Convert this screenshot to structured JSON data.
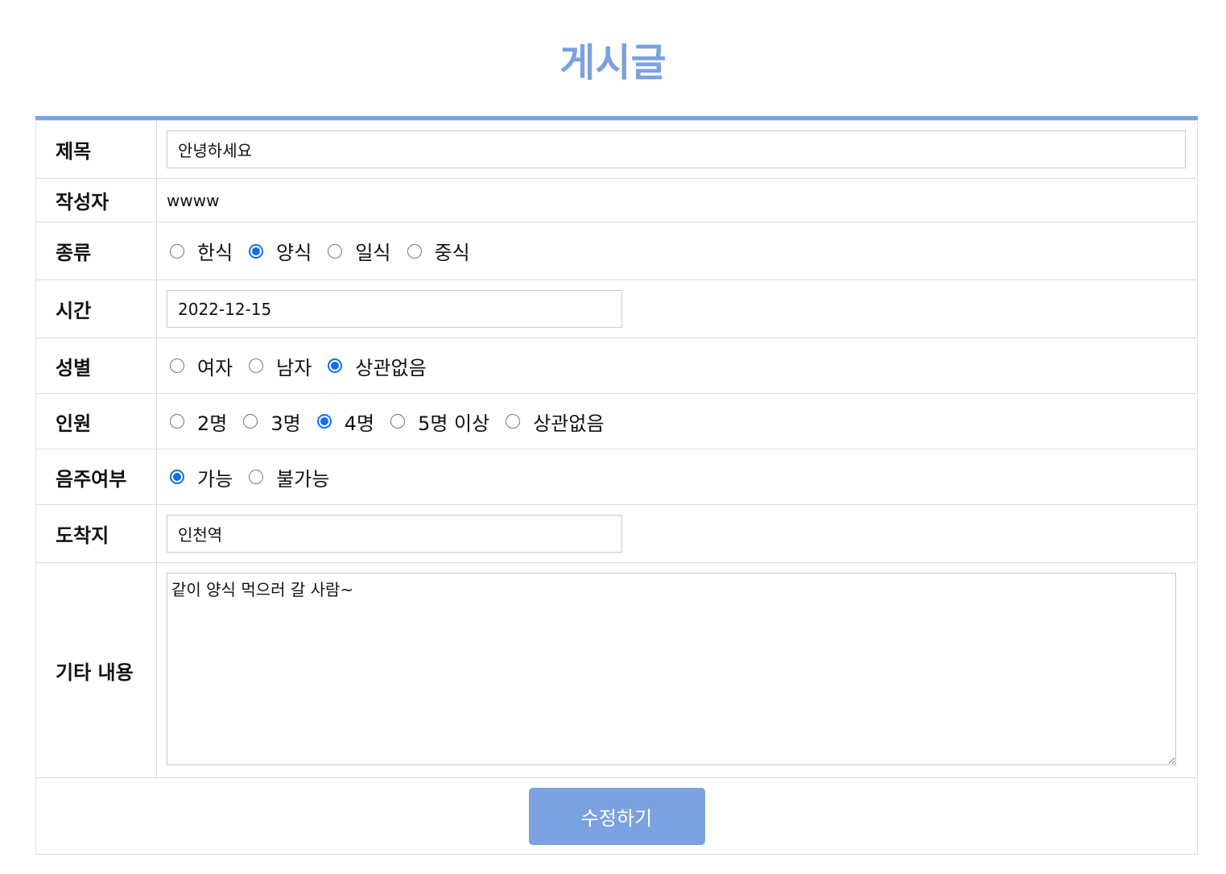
{
  "page": {
    "title": "게시글"
  },
  "form": {
    "title_label": "제목",
    "title_value": "안녕하세요",
    "author_label": "작성자",
    "author_value": "wwww",
    "category_label": "종류",
    "category_options": [
      {
        "label": "한식",
        "checked": false
      },
      {
        "label": "양식",
        "checked": true
      },
      {
        "label": "일식",
        "checked": false
      },
      {
        "label": "중식",
        "checked": false
      }
    ],
    "time_label": "시간",
    "time_value": "2022-12-15",
    "gender_label": "성별",
    "gender_options": [
      {
        "label": "여자",
        "checked": false
      },
      {
        "label": "남자",
        "checked": false
      },
      {
        "label": "상관없음",
        "checked": true
      }
    ],
    "people_label": "인원",
    "people_options": [
      {
        "label": "2명",
        "checked": false
      },
      {
        "label": "3명",
        "checked": false
      },
      {
        "label": "4명",
        "checked": true
      },
      {
        "label": "5명 이상",
        "checked": false
      },
      {
        "label": "상관없음",
        "checked": false
      }
    ],
    "drinking_label": "음주여부",
    "drinking_options": [
      {
        "label": "가능",
        "checked": true
      },
      {
        "label": "불가능",
        "checked": false
      }
    ],
    "destination_label": "도착지",
    "destination_value": "인천역",
    "memo_label": "기타 내용",
    "memo_value": "같이 양식 먹으러 갈 사람~",
    "submit_label": "수정하기"
  },
  "colors": {
    "accent": "#7aa2e0",
    "radio_checked": "#0f6ff0",
    "border": "#dcdcdc"
  }
}
